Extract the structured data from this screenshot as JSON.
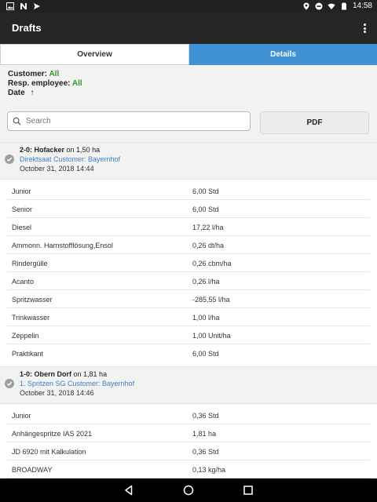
{
  "statusbar": {
    "time": "14:58"
  },
  "appbar": {
    "title": "Drafts"
  },
  "tabs": [
    {
      "label": "Overview",
      "active": false
    },
    {
      "label": "Details",
      "active": true
    }
  ],
  "filters": {
    "customer_label": "Customer:",
    "customer_value": "All",
    "employee_label": "Resp. employee:",
    "employee_value": "All",
    "date_label": "Date",
    "date_sort": "↑"
  },
  "search": {
    "placeholder": "Search",
    "value": ""
  },
  "pdf_button": "PDF",
  "drafts": [
    {
      "code": "2-0: Hofacker",
      "area": "on 1,50 ha",
      "task_customer": "Direktsaat Customer:  Bayernhof",
      "date": "October 31, 2018 14:44",
      "items": [
        {
          "name": "Junior",
          "value": "6,00 Std"
        },
        {
          "name": "Senior",
          "value": "6,00 Std"
        },
        {
          "name": "Diesel",
          "value": "17,22 l/ha"
        },
        {
          "name": "Ammonn. Harnstofflösung,Ensol",
          "value": "0,26 dt/ha"
        },
        {
          "name": "Rindergülle",
          "value": "0,26 cbm/ha"
        },
        {
          "name": "Acanto",
          "value": "0,26 l/ha"
        },
        {
          "name": "Spritzwasser",
          "value": "-285,55 l/ha"
        },
        {
          "name": "Trinkwasser",
          "value": "1,00 l/ha"
        },
        {
          "name": "Zeppelin",
          "value": "1,00 Unit/ha"
        },
        {
          "name": "Praktikant",
          "value": "6,00 Std"
        }
      ]
    },
    {
      "code": "1-0: Obern Dorf",
      "area": "on 1,81 ha",
      "task_customer": "1. Spritzen SG Customer:  Bayernhof",
      "date": "October 31, 2018 14:46",
      "items": [
        {
          "name": "Junior",
          "value": "0,36 Std"
        },
        {
          "name": "Anhängespritze IAS 2021",
          "value": "1,81 ha"
        },
        {
          "name": "JD 6920 mit Kalkulation",
          "value": "0,36 Std"
        },
        {
          "name": "BROADWAY",
          "value": "0,13 kg/ha"
        }
      ]
    }
  ]
}
